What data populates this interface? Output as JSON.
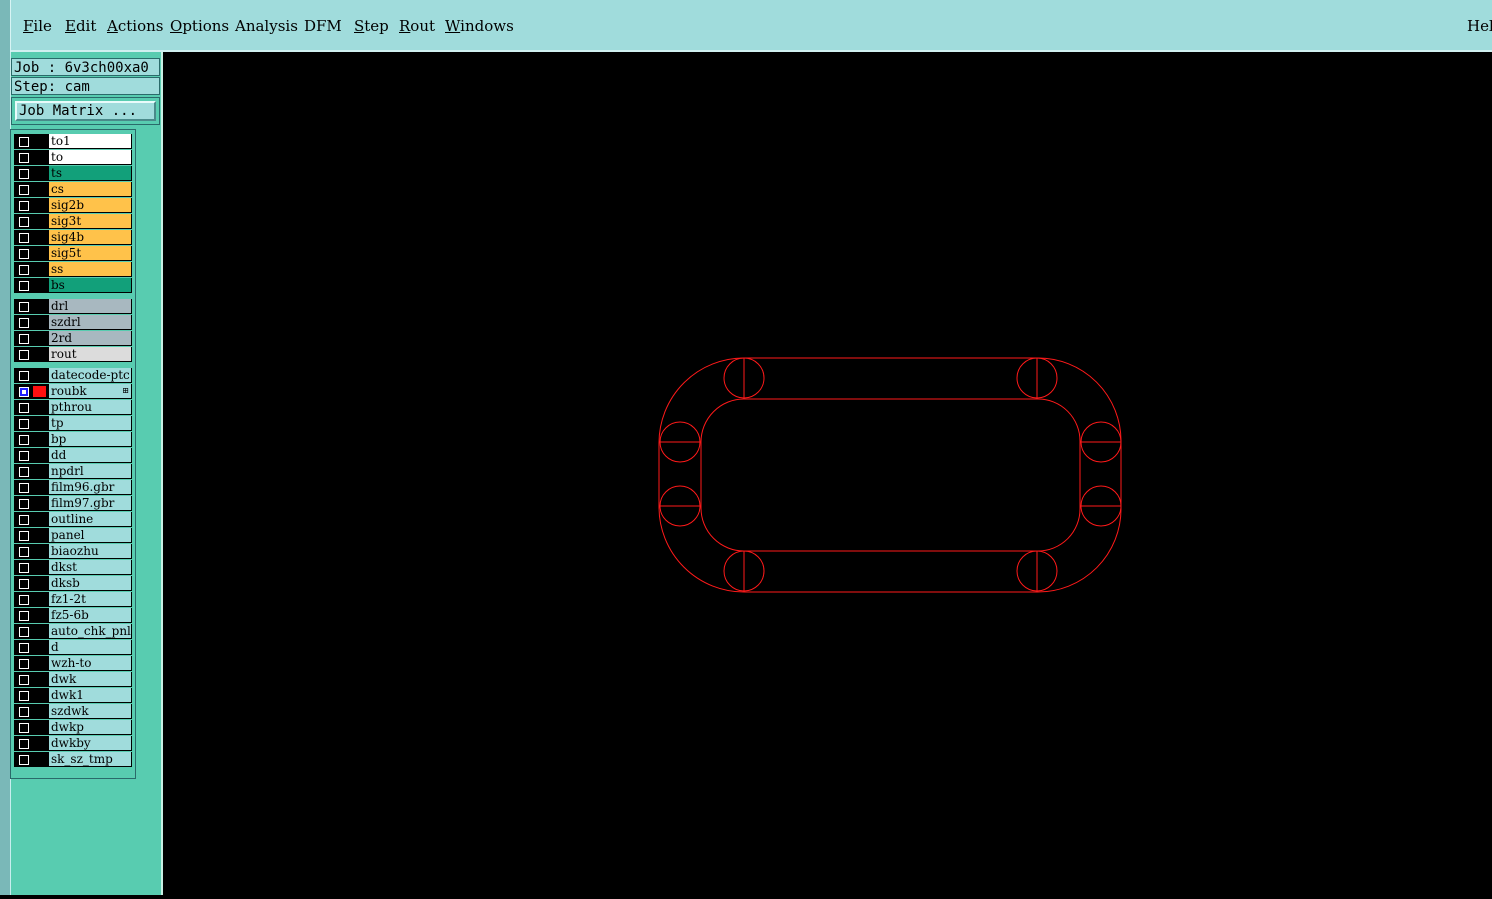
{
  "menu": {
    "file": "File",
    "edit": "Edit",
    "actions": "Actions",
    "options": "Options",
    "analysis": "Analysis",
    "dfm": "DFM",
    "step": "Step",
    "rout": "Rout",
    "windows": "Windows",
    "help": "Help"
  },
  "job": {
    "label": "Job : 6v3ch00xa0"
  },
  "step": {
    "label": "Step: cam"
  },
  "job_matrix_button": "Job Matrix ...",
  "layer_colors": {
    "white": "#ffffff",
    "teal": "#12a07a",
    "orange": "#ffc24a",
    "gray": "#a8b8c0",
    "lightgray": "#dcdcdc",
    "cyan": "#a0dcdc"
  },
  "layers": [
    {
      "name": "to1",
      "color": "white"
    },
    {
      "name": "to",
      "color": "white"
    },
    {
      "name": "ts",
      "color": "teal"
    },
    {
      "name": "cs",
      "color": "orange"
    },
    {
      "name": "sig2b",
      "color": "orange"
    },
    {
      "name": "sig3t",
      "color": "orange"
    },
    {
      "name": "sig4b",
      "color": "orange"
    },
    {
      "name": "sig5t",
      "color": "orange"
    },
    {
      "name": "ss",
      "color": "orange"
    },
    {
      "name": "bs",
      "color": "teal"
    },
    {
      "name": "drl",
      "color": "gray"
    },
    {
      "name": "szdrl",
      "color": "gray"
    },
    {
      "name": "2rd",
      "color": "gray"
    },
    {
      "name": "rout",
      "color": "lightgray"
    },
    {
      "name": "datecode-ptc",
      "color": "cyan"
    },
    {
      "name": "roubk",
      "color": "cyan",
      "active": true
    },
    {
      "name": "pthrou",
      "color": "cyan"
    },
    {
      "name": "tp",
      "color": "cyan"
    },
    {
      "name": "bp",
      "color": "cyan"
    },
    {
      "name": "dd",
      "color": "cyan"
    },
    {
      "name": "npdrl",
      "color": "cyan"
    },
    {
      "name": "film96.gbr",
      "color": "cyan"
    },
    {
      "name": "film97.gbr",
      "color": "cyan"
    },
    {
      "name": "outline",
      "color": "cyan"
    },
    {
      "name": "panel",
      "color": "cyan"
    },
    {
      "name": "biaozhu",
      "color": "cyan"
    },
    {
      "name": "dkst",
      "color": "cyan"
    },
    {
      "name": "dksb",
      "color": "cyan"
    },
    {
      "name": "fz1-2t",
      "color": "cyan"
    },
    {
      "name": "fz5-6b",
      "color": "cyan"
    },
    {
      "name": "auto_chk_pnl",
      "color": "cyan"
    },
    {
      "name": "d",
      "color": "cyan"
    },
    {
      "name": "wzh-to",
      "color": "cyan"
    },
    {
      "name": "dwk",
      "color": "cyan"
    },
    {
      "name": "dwk1",
      "color": "cyan"
    },
    {
      "name": "szdwk",
      "color": "cyan"
    },
    {
      "name": "dwkp",
      "color": "cyan"
    },
    {
      "name": "dwkby",
      "color": "cyan"
    },
    {
      "name": "sk_sz_tmp",
      "color": "cyan"
    }
  ],
  "canvas": {
    "background": "#000000",
    "stroke_color": "#ff1a1a"
  }
}
